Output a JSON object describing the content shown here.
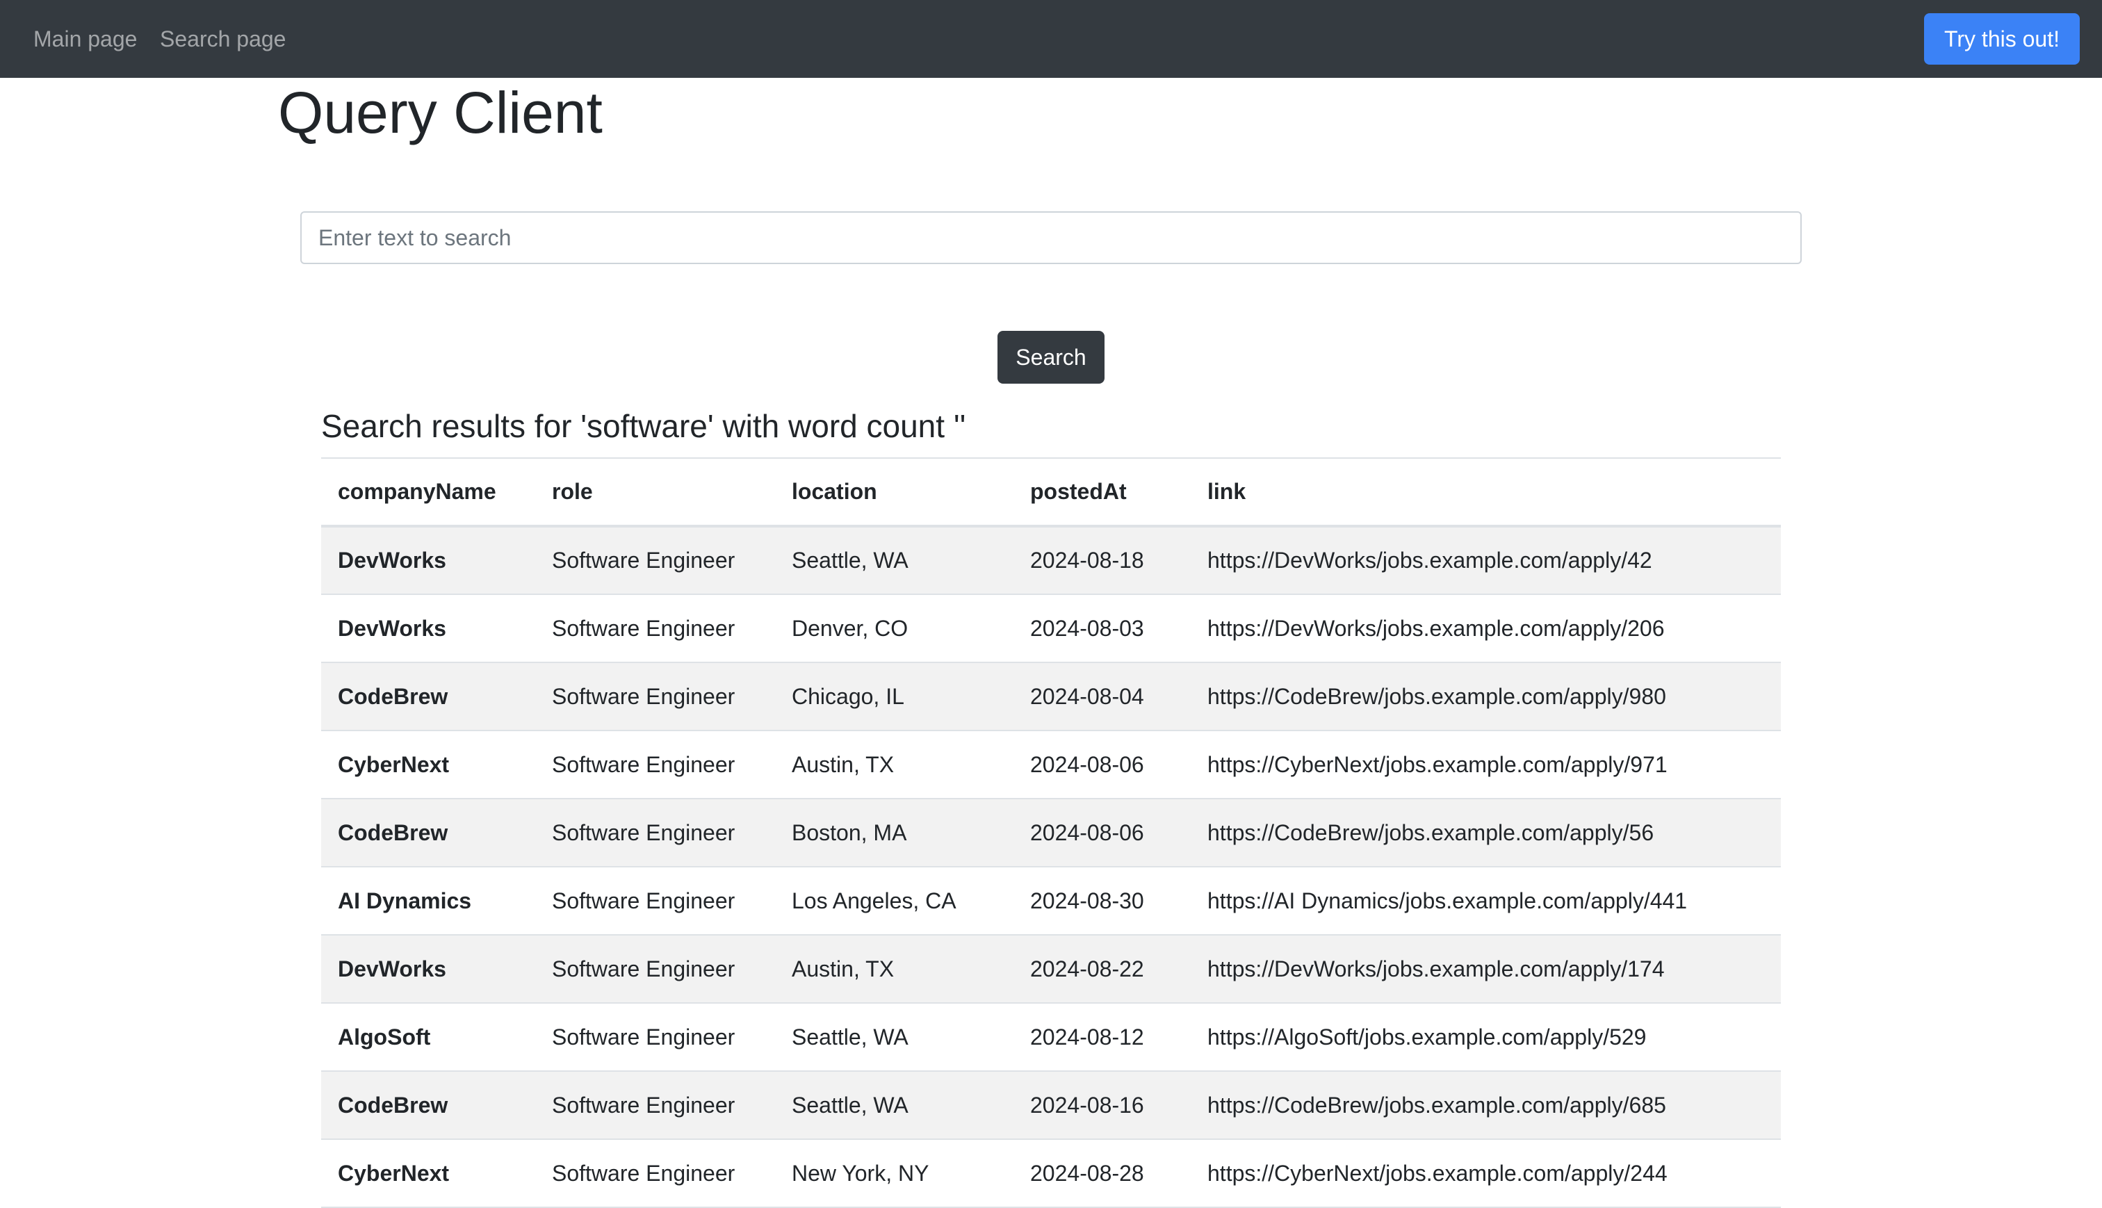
{
  "navbar": {
    "main_page": "Main page",
    "search_page": "Search page",
    "try_button": "Try this out!"
  },
  "page_title": "Query Client",
  "search": {
    "placeholder": "Enter text to search",
    "value": "",
    "button_label": "Search"
  },
  "results": {
    "heading": "Search results for 'software' with word count ''",
    "columns": [
      "companyName",
      "role",
      "location",
      "postedAt",
      "link"
    ],
    "rows": [
      [
        "DevWorks",
        "Software Engineer",
        "Seattle, WA",
        "2024-08-18",
        "https://DevWorks/jobs.example.com/apply/42"
      ],
      [
        "DevWorks",
        "Software Engineer",
        "Denver, CO",
        "2024-08-03",
        "https://DevWorks/jobs.example.com/apply/206"
      ],
      [
        "CodeBrew",
        "Software Engineer",
        "Chicago, IL",
        "2024-08-04",
        "https://CodeBrew/jobs.example.com/apply/980"
      ],
      [
        "CyberNext",
        "Software Engineer",
        "Austin, TX",
        "2024-08-06",
        "https://CyberNext/jobs.example.com/apply/971"
      ],
      [
        "CodeBrew",
        "Software Engineer",
        "Boston, MA",
        "2024-08-06",
        "https://CodeBrew/jobs.example.com/apply/56"
      ],
      [
        "AI Dynamics",
        "Software Engineer",
        "Los Angeles, CA",
        "2024-08-30",
        "https://AI Dynamics/jobs.example.com/apply/441"
      ],
      [
        "DevWorks",
        "Software Engineer",
        "Austin, TX",
        "2024-08-22",
        "https://DevWorks/jobs.example.com/apply/174"
      ],
      [
        "AlgoSoft",
        "Software Engineer",
        "Seattle, WA",
        "2024-08-12",
        "https://AlgoSoft/jobs.example.com/apply/529"
      ],
      [
        "CodeBrew",
        "Software Engineer",
        "Seattle, WA",
        "2024-08-16",
        "https://CodeBrew/jobs.example.com/apply/685"
      ],
      [
        "CyberNext",
        "Software Engineer",
        "New York, NY",
        "2024-08-28",
        "https://CyberNext/jobs.example.com/apply/244"
      ]
    ]
  },
  "colors": {
    "navbar_bg": "#343a40",
    "primary_button": "#3b82f6",
    "dark_button": "#343a40",
    "striped_row": "#f2f2f2"
  }
}
